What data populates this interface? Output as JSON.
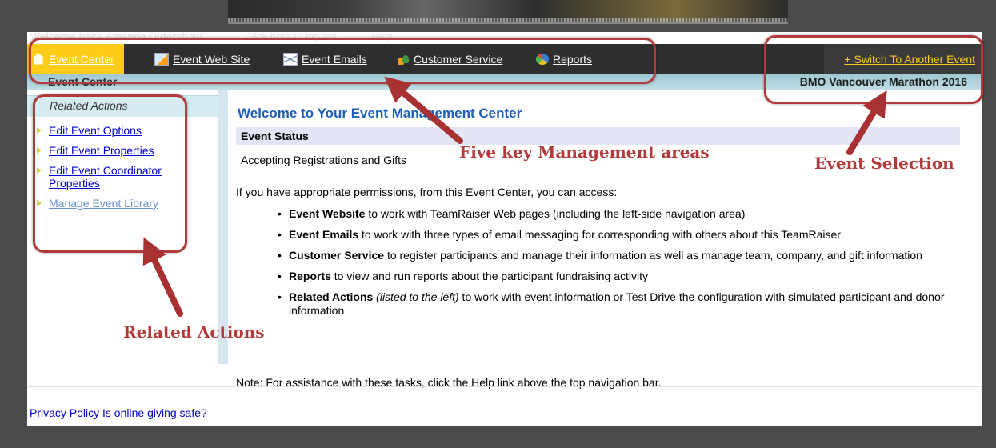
{
  "header": {
    "welcome": "Welcome back Amanda Oldershaw",
    "logout": "Click here to log out",
    "help": "Help"
  },
  "nav": {
    "items": [
      {
        "label": "Event Center",
        "icon": "home-icon",
        "active": true
      },
      {
        "label": "Event Web Site",
        "icon": "web-page-icon"
      },
      {
        "label": "Event Emails",
        "icon": "envelope-icon"
      },
      {
        "label": "Customer Service",
        "icon": "people-icon"
      },
      {
        "label": "Reports",
        "icon": "pie-chart-icon"
      }
    ],
    "switch_event": "+ Switch To Another Event"
  },
  "subheader": {
    "title": "Event Center",
    "event_name": "BMO Vancouver Marathon 2016"
  },
  "sidebar": {
    "heading": "Related Actions",
    "links": [
      {
        "label": "Edit Event Options"
      },
      {
        "label": "Edit Event Properties"
      },
      {
        "label": "Edit Event Coordinator Properties"
      },
      {
        "label": "Manage Event Library"
      }
    ]
  },
  "main": {
    "title": "Welcome to Your Event Management Center",
    "status_heading": "Event Status",
    "status_value": "Accepting Registrations and Gifts",
    "intro": "If you have appropriate permissions, from this Event Center, you can access:",
    "bullets": [
      {
        "bold": "Event Website",
        "rest": " to work with TeamRaiser Web pages (including the left-side navigation area)"
      },
      {
        "bold": "Event Emails",
        "rest": " to work with three types of email messaging for corresponding with others about this TeamRaiser"
      },
      {
        "bold": "Customer Service",
        "rest": " to register participants and manage their information as well as manage team, company, and gift information"
      },
      {
        "bold": "Reports",
        "rest": " to view and run reports about the participant fundraising activity"
      },
      {
        "bold": "Related Actions",
        "italic": " (listed to the left)",
        "rest": " to work with event information or Test Drive the configuration with simulated participant and donor information"
      }
    ],
    "note": "Note: For assistance with these tasks, click the Help link above the top navigation bar."
  },
  "footer": {
    "privacy": "Privacy Policy",
    "safe": "Is online giving safe?"
  },
  "annotations": {
    "five_areas": "Five key Management areas",
    "event_selection": "Event Selection",
    "related_actions": "Related Actions",
    "color": "#b23a3a"
  },
  "colors": {
    "nav_bg": "#2e2e2e",
    "active_tab": "#ffcc1a",
    "title_blue": "#1d5fb8",
    "status_bg": "#e4e6f7"
  }
}
